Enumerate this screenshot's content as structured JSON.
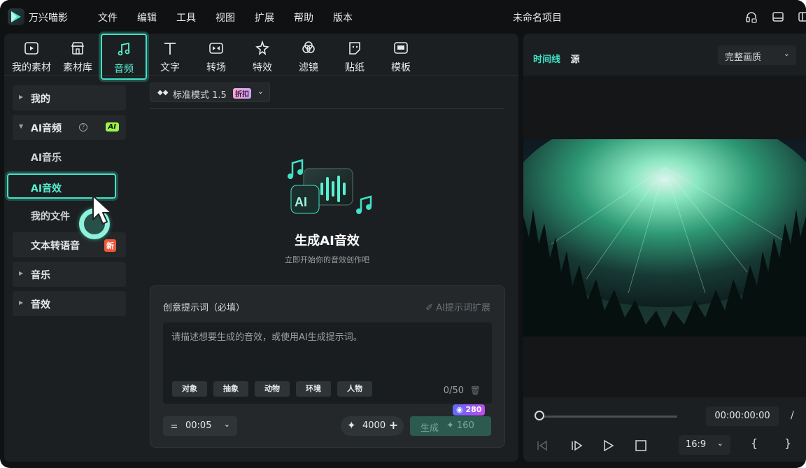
{
  "app": {
    "title": "万兴喵影",
    "project_name": "未命名项目"
  },
  "menu": [
    "文件",
    "编辑",
    "工具",
    "视图",
    "扩展",
    "帮助",
    "版本"
  ],
  "toolbar": {
    "tools": [
      {
        "label": "我的素材",
        "icon": "media-icon"
      },
      {
        "label": "素材库",
        "icon": "library-icon"
      },
      {
        "label": "音频",
        "icon": "music-note-icon",
        "active": true
      },
      {
        "label": "文字",
        "icon": "text-icon"
      },
      {
        "label": "转场",
        "icon": "transition-icon"
      },
      {
        "label": "特效",
        "icon": "effects-icon"
      },
      {
        "label": "滤镜",
        "icon": "filter-icon"
      },
      {
        "label": "贴纸",
        "icon": "sticker-icon"
      },
      {
        "label": "模板",
        "icon": "template-icon"
      }
    ]
  },
  "sidebar": {
    "mine": "我的",
    "ai_audio": "AI音频",
    "ai_badge": "AI",
    "ai_music": "AI音乐",
    "ai_sfx": "AI音效",
    "my_files": "我的文件",
    "tts": "文本转语音",
    "new_badge": "新",
    "music": "音乐",
    "sfx": "音效"
  },
  "model": {
    "label": "标准模式 1.5",
    "discount": "折扣"
  },
  "hero": {
    "title": "生成AI音效",
    "subtitle": "立即开始你的音效创作吧",
    "icon_text": "AI"
  },
  "prompt": {
    "label": "创意提示词（必填）",
    "extend": "AI提示词扩展",
    "placeholder": "请描述想要生成的音效，或使用AI生成提示词。",
    "chips": [
      "对象",
      "抽象",
      "动物",
      "环境",
      "人物"
    ],
    "count": "0/50"
  },
  "footer": {
    "duration": "00:05",
    "credits": "4000",
    "generate": "生成",
    "generate_cost": "160",
    "badge_cost": "280"
  },
  "preview": {
    "tab_timeline": "时间线",
    "tab_source": "源",
    "quality": "完整画质",
    "timecode": "00:00:00:00",
    "slash": "/",
    "ratio": "16:9",
    "bracket_in": "{",
    "bracket_out": "}"
  },
  "colors": {
    "accent": "#3fe3c8",
    "background": "#0f1112",
    "panel": "#1c1f21"
  }
}
